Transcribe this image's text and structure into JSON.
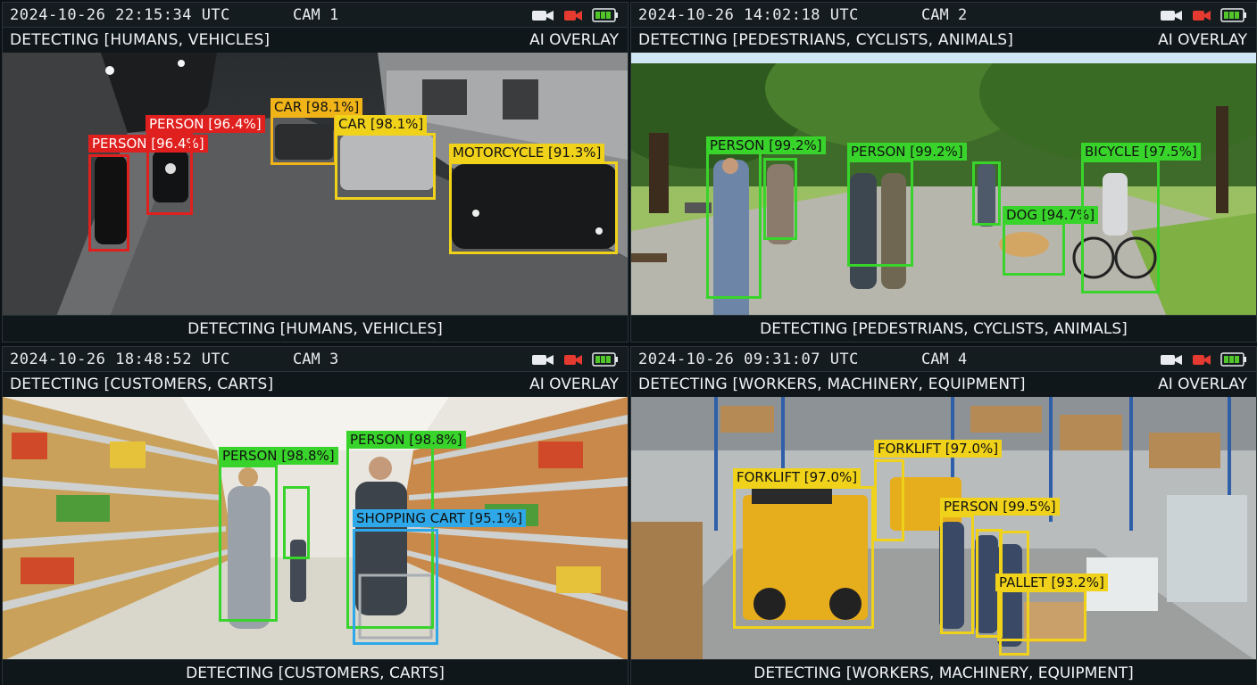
{
  "colors": {
    "red": "#e0201e",
    "yellow": "#f0d21a",
    "green": "#39d42b",
    "blue": "#2ea8e8",
    "record": "#e43a30",
    "battery": "#52c52b"
  },
  "icons": [
    "video-camera-icon",
    "record-camera-icon",
    "battery-icon"
  ],
  "cams": [
    {
      "timestamp": "2024-10-26 22:15:34 UTC",
      "name": "CAM 1",
      "detecting": "DETECTING [HUMANS, VEHICLES]",
      "overlay": "AI OVERLAY",
      "bottom": "DETECTING [HUMANS, VEHICLES]",
      "detections": [
        {
          "label": "PERSON [96.4%]",
          "color": "red"
        },
        {
          "label": "PERSON [96.4%]",
          "color": "red"
        },
        {
          "label": "CAR [98.1%]",
          "color": "yellow"
        },
        {
          "label": "CAR [98.1%]",
          "color": "yellow"
        },
        {
          "label": "MOTORCYCLE [91.3%]",
          "color": "yellow"
        }
      ]
    },
    {
      "timestamp": "2024-10-26 14:02:18 UTC",
      "name": "CAM 2",
      "detecting": "DETECTING [PEDESTRIANS, CYCLISTS, ANIMALS]",
      "overlay": "AI OVERLAY",
      "bottom": "DETECTING [PEDESTRIANS, CYCLISTS, ANIMALS]",
      "detections": [
        {
          "label": "PERSON [99.2%]",
          "color": "green"
        },
        {
          "label": "PERSON [99.2%]",
          "color": "green"
        },
        {
          "label": "DOG [94.7%]",
          "color": "green"
        },
        {
          "label": "BICYCLE [97.5%]",
          "color": "green"
        }
      ]
    },
    {
      "timestamp": "2024-10-26 18:48:52 UTC",
      "name": "CAM 3",
      "detecting": "DETECTING [CUSTOMERS, CARTS]",
      "overlay": "AI OVERLAY",
      "bottom": "DETECTING [CUSTOMERS, CARTS]",
      "detections": [
        {
          "label": "PERSON [98.8%]",
          "color": "green"
        },
        {
          "label": "PERSON [98.8%]",
          "color": "green"
        },
        {
          "label": "SHOPPING CART [95.1%]",
          "color": "blue"
        }
      ]
    },
    {
      "timestamp": "2024-10-26 09:31:07 UTC",
      "name": "CAM 4",
      "detecting": "DETECTING [WORKERS, MACHINERY, EQUIPMENT]",
      "overlay": "AI OVERLAY",
      "bottom": "DETECTING [WORKERS, MACHINERY, EQUIPMENT]",
      "detections": [
        {
          "label": "FORKLIFT [97.0%]",
          "color": "yellow"
        },
        {
          "label": "FORKLIFT [97.0%]",
          "color": "yellow"
        },
        {
          "label": "PERSON [99.5%]",
          "color": "yellow"
        },
        {
          "label": "PALLET [93.2%]",
          "color": "yellow"
        }
      ]
    }
  ]
}
